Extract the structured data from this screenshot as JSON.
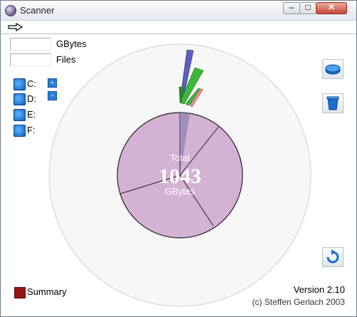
{
  "window": {
    "title": "Scanner"
  },
  "info": {
    "gbytes_label": "GBytes",
    "files_label": "Files",
    "gbytes_value": "",
    "files_value": ""
  },
  "drives": [
    {
      "label": "C:"
    },
    {
      "label": "D:"
    },
    {
      "label": "E:"
    },
    {
      "label": "F:"
    }
  ],
  "toolbar": {
    "buttons": [
      "drive-icon",
      "trash-icon",
      "refresh-icon"
    ]
  },
  "center": {
    "total_label": "Total",
    "total_value": "1043",
    "unit": "GBytes"
  },
  "summary": {
    "label": "Summary"
  },
  "footer": {
    "version": "Version 2.10",
    "copyright": "(c) Steffen Gerlach 2003"
  }
}
